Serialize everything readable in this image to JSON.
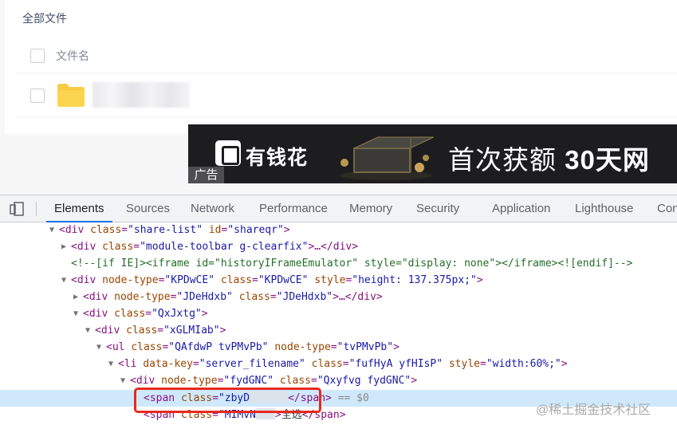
{
  "file_page": {
    "breadcrumb": "全部文件",
    "column_filename": "文件名"
  },
  "ad": {
    "brand": "有钱花",
    "headline": "首次获额 ",
    "headline_bold": "30天",
    "headline_tail": "网",
    "tag": "广告"
  },
  "devtools": {
    "tabs": [
      "Elements",
      "Sources",
      "Network",
      "Performance",
      "Memory",
      "Security",
      "Application",
      "Lighthouse",
      "Con"
    ],
    "active_tab": "Elements"
  },
  "tree": {
    "l1_tag": "div",
    "l1_attr": "class",
    "l1_val": "\"share-list\"",
    "l1_attr2": "id",
    "l1_val2": "\"shareqr\"",
    "l2_tag": "div",
    "l2_attr": "class",
    "l2_val": "\"module-toolbar g-clearfix\"",
    "l2_tail": "…</div>",
    "l3_comment": "<!--[if IE]><iframe id=\"historyIFrameEmulator\" style=\"display: none\"></iframe><![endif]-->",
    "l4_tag": "div",
    "l4_a1": "node-type",
    "l4_v1": "\"KPDwCE\"",
    "l4_a2": "class",
    "l4_v2": "\"KPDwCE\"",
    "l4_a3": "style",
    "l4_v3": "\"height: 137.375px;\"",
    "l5_tag": "div",
    "l5_a1": "node-type",
    "l5_v1": "\"JDeHdxb\"",
    "l5_a2": "class",
    "l5_v2": "\"JDeHdxb\"",
    "l5_tail": "…</div>",
    "l6_tag": "div",
    "l6_a1": "class",
    "l6_v1": "\"QxJxtg\"",
    "l7_tag": "div",
    "l7_a1": "class",
    "l7_v1": "\"xGLMIab\"",
    "l8_tag": "ul",
    "l8_a1": "class",
    "l8_v1": "\"QAfdwP tvPMvPb\"",
    "l8_a2": "node-type",
    "l8_v2": "\"tvPMvPb\"",
    "l9_tag": "li",
    "l9_a1": "data-key",
    "l9_v1": "\"server_filename\"",
    "l9_a2": "class",
    "l9_v2": "\"fufHyA yfHIsP\"",
    "l9_a3": "style",
    "l9_v3": "\"width:60%;\"",
    "l10_tag": "div",
    "l10_a1": "node-type",
    "l10_v1": "\"fydGNC\"",
    "l10_a2": "class",
    "l10_v2": "\"Qxyfvg fydGNC\"",
    "l11_tag": "span",
    "l11_a1": "class",
    "l11_v1": "\"zbyD",
    "l11_close": "</span>",
    "l11_suffix": " == $0",
    "l12_tag": "span",
    "l12_a1": "class",
    "l12_v1": "\"MIMvN",
    "l12_text": "全选",
    "l12_close": "</span>"
  },
  "watermark": "@稀土掘金技术社区"
}
